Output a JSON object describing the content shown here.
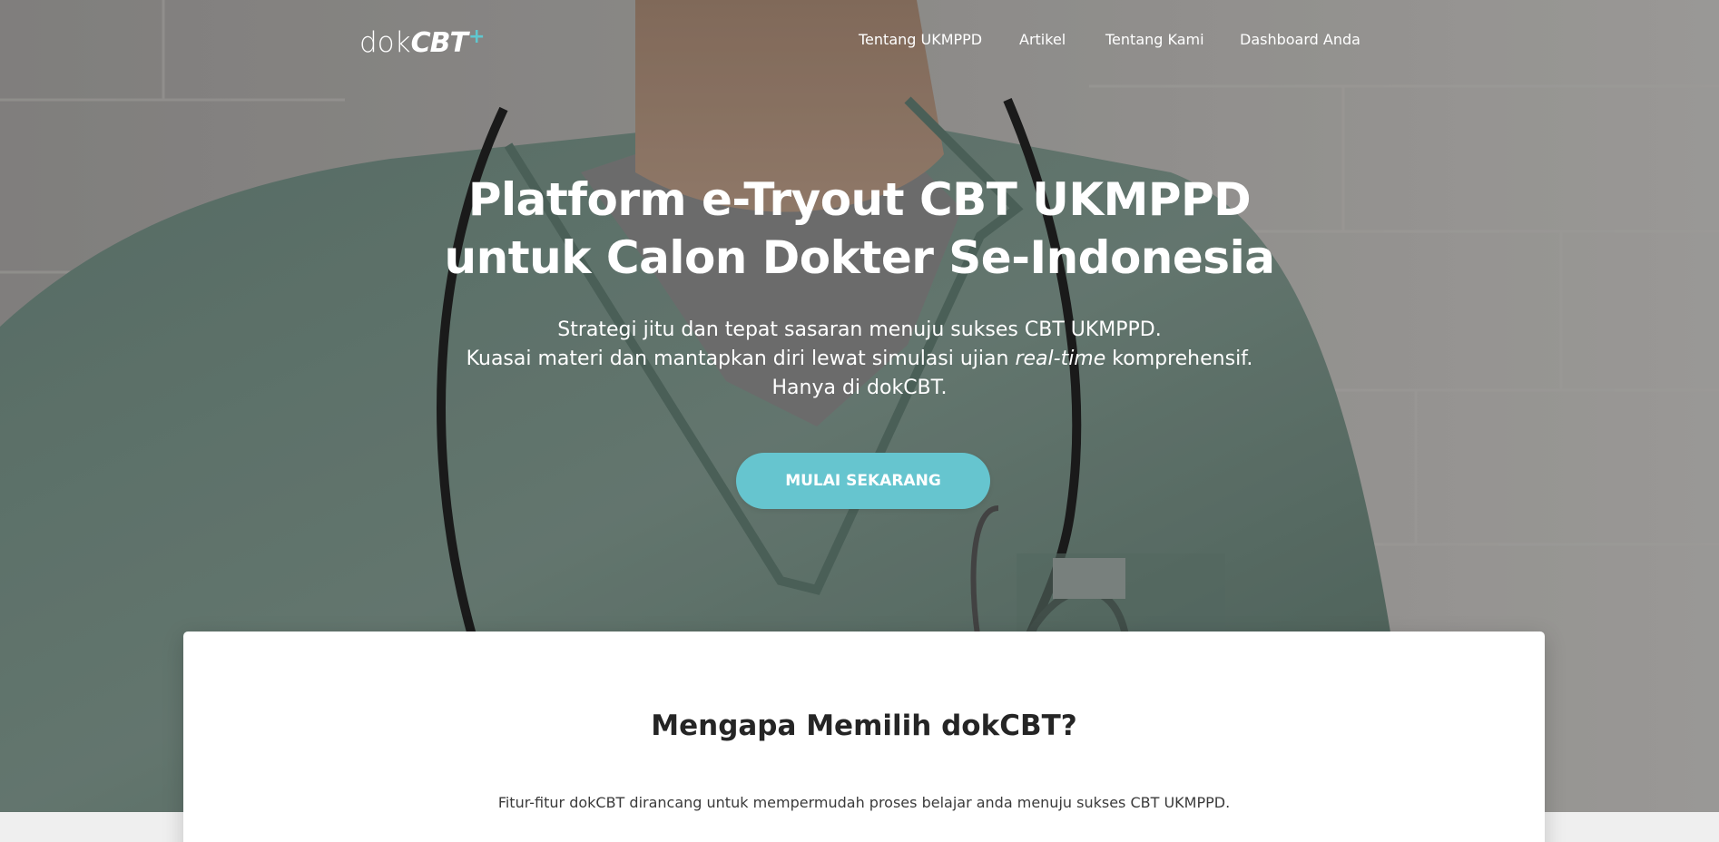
{
  "brand": {
    "logo_light": "dok",
    "logo_bold": "CBT",
    "logo_plus": "+",
    "accent_color": "#66c5cf"
  },
  "nav": {
    "items": [
      {
        "label": "Tentang UKMPPD"
      },
      {
        "label": "Artikel"
      },
      {
        "label": "Tentang Kami"
      },
      {
        "label": "Dashboard Anda"
      }
    ]
  },
  "hero": {
    "title_line1": "Platform e-Tryout CBT UKMPPD",
    "title_line2": "untuk Calon Dokter Se-Indonesia",
    "sub_line1": "Strategi jitu dan tepat sasaran menuju sukses CBT UKMPPD.",
    "sub_line2_pre": "Kuasai materi dan mantapkan diri lewat simulasi ujian ",
    "sub_line2_em": "real-time",
    "sub_line2_post": " komprehensif.",
    "sub_line3": "Hanya di dokCBT.",
    "cta_label": "MULAI SEKARANG",
    "background_image": "doctor-with-stethoscope-photo"
  },
  "features": {
    "title": "Mengapa Memilih dokCBT?",
    "description": "Fitur-fitur dokCBT dirancang untuk mempermudah proses belajar anda menuju sukses CBT UKMPPD."
  }
}
